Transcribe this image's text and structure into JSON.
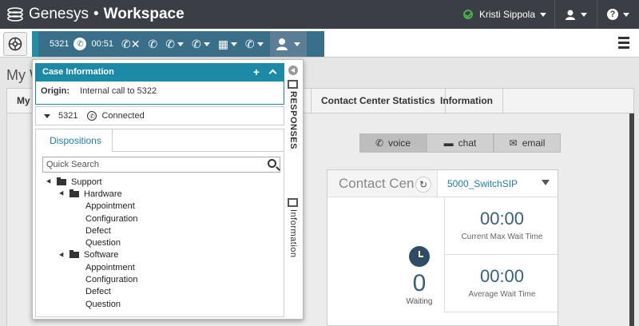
{
  "app": {
    "brand": "Genesys",
    "separator": "•",
    "product": "Workspace"
  },
  "user": {
    "name": "Kristi Sippola",
    "status": "ready"
  },
  "topbar": {
    "help_label": "?"
  },
  "callbar": {
    "extension": "5321",
    "timer": "00:51"
  },
  "page": {
    "title": "My W"
  },
  "bg_tabs": [
    {
      "label": "My"
    },
    {
      "label": "Contact Center Statistics"
    },
    {
      "label": "Information"
    }
  ],
  "media_tabs": [
    {
      "label": "voice"
    },
    {
      "label": "chat"
    },
    {
      "label": "email"
    }
  ],
  "contact_center": {
    "title": "Contact Cen",
    "selected": "5000_SwitchSIP",
    "waiting_value": "0",
    "waiting_label": "Waiting",
    "stats": [
      {
        "value": "00:00",
        "label": "Current Max Wait Time"
      },
      {
        "value": "00:00",
        "label": "Average Wait Time"
      }
    ]
  },
  "case_info": {
    "title": "Case Information",
    "add_label": "+",
    "origin_label": "Origin:",
    "origin_value": "Internal call to 5322"
  },
  "connection": {
    "extension": "5321",
    "status": "Connected"
  },
  "dispositions": {
    "tab_label": "Dispositions",
    "search_placeholder": "Quick Search",
    "tree": [
      {
        "label": "Support",
        "type": "folder",
        "level": 1
      },
      {
        "label": "Hardware",
        "type": "folder",
        "level": 2
      },
      {
        "label": "Appointment",
        "type": "leaf"
      },
      {
        "label": "Configuration",
        "type": "leaf"
      },
      {
        "label": "Defect",
        "type": "leaf"
      },
      {
        "label": "Question",
        "type": "leaf"
      },
      {
        "label": "Software",
        "type": "folder",
        "level": 2
      },
      {
        "label": "Appointment",
        "type": "leaf"
      },
      {
        "label": "Configuration",
        "type": "leaf"
      },
      {
        "label": "Defect",
        "type": "leaf"
      },
      {
        "label": "Question",
        "type": "leaf"
      }
    ]
  },
  "side_tabs": {
    "responses": "RESPONSES",
    "information": "Information"
  },
  "colors": {
    "topbar": "#3b3f45",
    "accent": "#1c8aa6",
    "callbar": "#3a6f8a",
    "status_green": "#4cb04c"
  }
}
